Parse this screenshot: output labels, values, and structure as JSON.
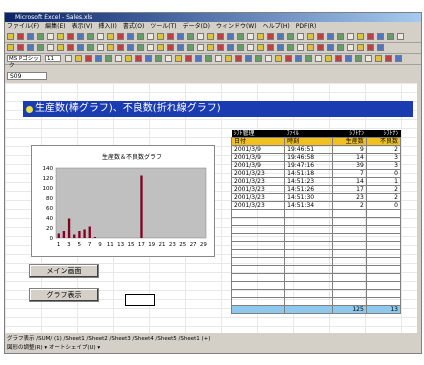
{
  "window": {
    "title": "Microsoft Excel - Sales.xls"
  },
  "menu": [
    "ファイル(F)",
    "編集(E)",
    "表示(V)",
    "挿入(I)",
    "書式(O)",
    "ツール(T)",
    "データ(D)",
    "ウィンドウ(W)",
    "ヘルプ(H)",
    "PDF(R)"
  ],
  "formatbar": {
    "font": "MS Pゴシック",
    "size": "11",
    "namebox": "S09"
  },
  "sheet": {
    "heading": "生産数(棒グラフ)、不良数(折れ線グラフ)",
    "chart_title": "生産数＆不良数グラフ",
    "buttons": {
      "main": "メイン画面",
      "graph": "グラフ表示"
    }
  },
  "table": {
    "top_labels": [
      "ｼﾌﾄ管理",
      "ﾌｧｲﾙ",
      "ｼﾌﾄﾅﾝ",
      "ｼﾌﾄﾅﾝ"
    ],
    "headers": [
      "日付",
      "時刻",
      "生産数",
      "不良数"
    ],
    "rows": [
      [
        "2001/3/9",
        "19:46:51",
        "9",
        "2"
      ],
      [
        "2001/3/9",
        "19:46:58",
        "14",
        "3"
      ],
      [
        "2001/3/9",
        "19:47:16",
        "39",
        "3"
      ],
      [
        "2001/3/23",
        "14:51:18",
        "7",
        "0"
      ],
      [
        "2001/3/23",
        "14:51:23",
        "14",
        "1"
      ],
      [
        "2001/3/23",
        "14:51:26",
        "17",
        "2"
      ],
      [
        "2001/3/23",
        "14:51:30",
        "23",
        "2"
      ],
      [
        "2001/3/23",
        "14:51:34",
        "2",
        "0"
      ]
    ],
    "totals": [
      "",
      "",
      "125",
      "13"
    ]
  },
  "tabs_text": "グラフ表示 /SUM/ (1) /Sheet1 /Sheet2 /Sheet3 /Sheet4 /Sheet5 /Sheet1 (+)",
  "status_text": "図形の調整(R) ▾  オートシェイプ(U) ▾",
  "chart_data": {
    "type": "bar",
    "title": "生産数＆不良数グラフ",
    "categories": [
      "1",
      "2",
      "3",
      "4",
      "5",
      "6",
      "7",
      "8",
      "9",
      "10",
      "11",
      "12",
      "13",
      "14",
      "15",
      "16",
      "17",
      "18",
      "19",
      "20",
      "21",
      "22",
      "23",
      "24",
      "25",
      "26",
      "27",
      "28",
      "29"
    ],
    "values": [
      9,
      14,
      39,
      7,
      14,
      17,
      23,
      2,
      0,
      0,
      0,
      0,
      0,
      0,
      0,
      0,
      125,
      0,
      0,
      0,
      0,
      0,
      0,
      0,
      0,
      0,
      0,
      0,
      0
    ],
    "tick_labels": [
      "1",
      "3",
      "5",
      "7",
      "9",
      "11",
      "13",
      "15",
      "17",
      "19",
      "21",
      "23",
      "25",
      "27",
      "29"
    ],
    "y_ticks": [
      "0",
      "20",
      "40",
      "60",
      "80",
      "100",
      "120",
      "140"
    ],
    "ylim": [
      0,
      140
    ],
    "colors": {
      "bar": "#800020",
      "plot_bg": "#c0c0c0"
    }
  }
}
